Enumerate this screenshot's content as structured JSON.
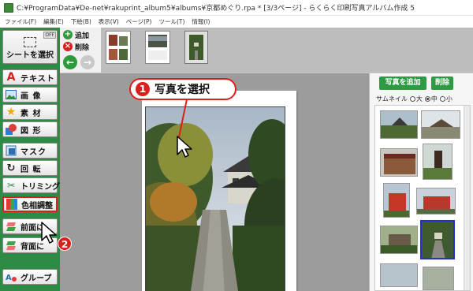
{
  "window": {
    "title": "C:¥ProgramData¥De-net¥rakuprint_album5¥albums¥京都めぐり.rpa * [3/3ページ] - らくらく印刷写真アルバム作成 5"
  },
  "menu": [
    "ファイル(F)",
    "編集(E)",
    "下絵(B)",
    "表示(V)",
    "ページ(P)",
    "ツール(T)",
    "情報(I)"
  ],
  "left_tools": {
    "off_badge": "OFF",
    "sheet_select": "シートを選択",
    "items": [
      {
        "label": "テキスト",
        "icon": "text-icon"
      },
      {
        "label": "画 像",
        "icon": "image-icon"
      },
      {
        "label": "素 材",
        "icon": "star-icon"
      },
      {
        "label": "図 形",
        "icon": "shape-icon"
      },
      {
        "label": "マスク",
        "icon": "mask-icon"
      },
      {
        "label": "回 転",
        "icon": "rotate-icon"
      },
      {
        "label": "トリミング",
        "icon": "scissors-icon"
      },
      {
        "label": "色相調整",
        "icon": "color-adjust-icon"
      },
      {
        "label": "前面に",
        "icon": "bring-front-icon"
      },
      {
        "label": "背面に",
        "icon": "send-back-icon"
      },
      {
        "label": "グループ",
        "icon": "group-icon"
      }
    ]
  },
  "page_toolbar": {
    "add_label": "追加",
    "delete_label": "削除"
  },
  "right_panel": {
    "add_photo_label": "写真を追加",
    "delete_label": "削除",
    "thumbnail_label": "サムネイル",
    "size_large": "大",
    "size_medium": "中",
    "size_small": "小",
    "selected_size": "中"
  },
  "callouts": {
    "step1_number": "1",
    "step1_text": "写真を選択",
    "step2_number": "2"
  },
  "colors": {
    "panel_green": "#2e8b45",
    "accent_red": "#d9201c",
    "selection_blue": "#2030c8"
  }
}
